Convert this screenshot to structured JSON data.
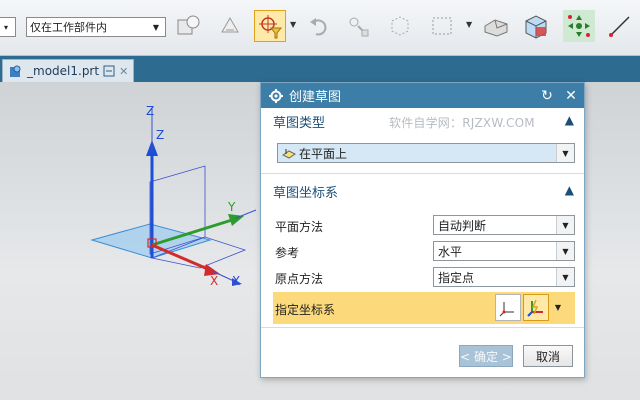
{
  "toolbar": {
    "combo_left_arrow": "▾",
    "filter_value": "仅在工作部件内",
    "icons": [
      "body-icon",
      "shell-icon",
      "select-filter-icon",
      "snap-point-icon",
      "funnel-icon",
      "rotate-icon",
      "point-icon",
      "cube-wire-icon",
      "select-box-icon",
      "solid-icon",
      "view-cube-icon",
      "snap-grid-icon",
      "line-icon"
    ]
  },
  "tab": {
    "label": "_model1.prt",
    "close": "✕"
  },
  "viewport": {
    "axis_labels": {
      "z1": "Z",
      "z2": "Z",
      "y": "Y",
      "x1": "X",
      "x2": "X"
    },
    "colors": {
      "z": "#1c4fd6",
      "y": "#2e9b2e",
      "x": "#d22b2b",
      "plane": "#8fc7f0"
    }
  },
  "dialog": {
    "title": "创建草图",
    "reset_icon": "↻",
    "close_icon": "✕",
    "section1": {
      "title": "草图类型",
      "watermark": "软件自学网：RJZXW.COM",
      "type_value": "在平面上"
    },
    "section2": {
      "title": "草图坐标系",
      "rows": [
        {
          "label": "平面方法",
          "value": "自动判断"
        },
        {
          "label": "参考",
          "value": "水平"
        },
        {
          "label": "原点方法",
          "value": "指定点"
        }
      ],
      "csys_label": "指定坐标系"
    },
    "ok_label": "< 确定 >",
    "cancel_label": "取消"
  }
}
